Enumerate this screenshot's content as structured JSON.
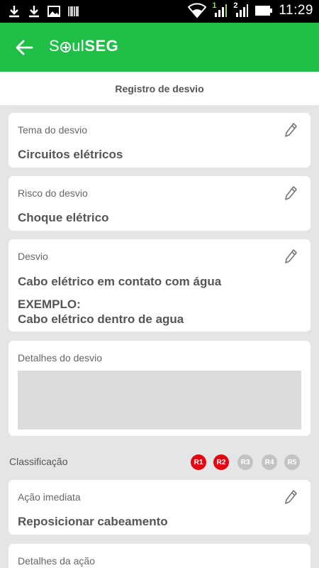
{
  "status_bar": {
    "time": "11:29",
    "colors": {
      "background": "#000000",
      "text": "#ffffff"
    },
    "icons": [
      "download-icon",
      "download-icon",
      "image-icon",
      "barcode-icon",
      "wifi-icon",
      "signal-sim1-icon",
      "signal-sim2-icon",
      "battery-icon"
    ],
    "sim1_label": "1",
    "sim2_label": "2"
  },
  "app_bar": {
    "brand_prefix": "S",
    "brand_mid": "ul",
    "brand_bold": "SEG",
    "color": "#1fbf47"
  },
  "page": {
    "title": "Registro de desvio"
  },
  "fields": {
    "tema": {
      "label": "Tema do desvio",
      "value": "Circuitos elétricos"
    },
    "risco": {
      "label": "Risco do desvio",
      "value": "Choque elétrico"
    },
    "desvio": {
      "label": "Desvio",
      "value_line1": "Cabo elétrico em contato com água",
      "value_line2": "EXEMPLO:",
      "value_line3": "Cabo elétrico dentro de agua"
    },
    "detalhes": {
      "label": "Detalhes do desvio",
      "value": ""
    },
    "acao": {
      "label": "Ação imediata",
      "value": "Reposicionar cabeamento"
    },
    "detalhes_acao": {
      "label": "Detalhes da ação"
    }
  },
  "classification": {
    "label": "Classificação",
    "badges": [
      {
        "label": "R1",
        "active": true
      },
      {
        "label": "R2",
        "active": true
      },
      {
        "label": "R3",
        "active": false
      },
      {
        "label": "R4",
        "active": false
      },
      {
        "label": "R5",
        "active": false
      }
    ],
    "active_color": "#e30613",
    "inactive_color": "#c3c3c3"
  }
}
